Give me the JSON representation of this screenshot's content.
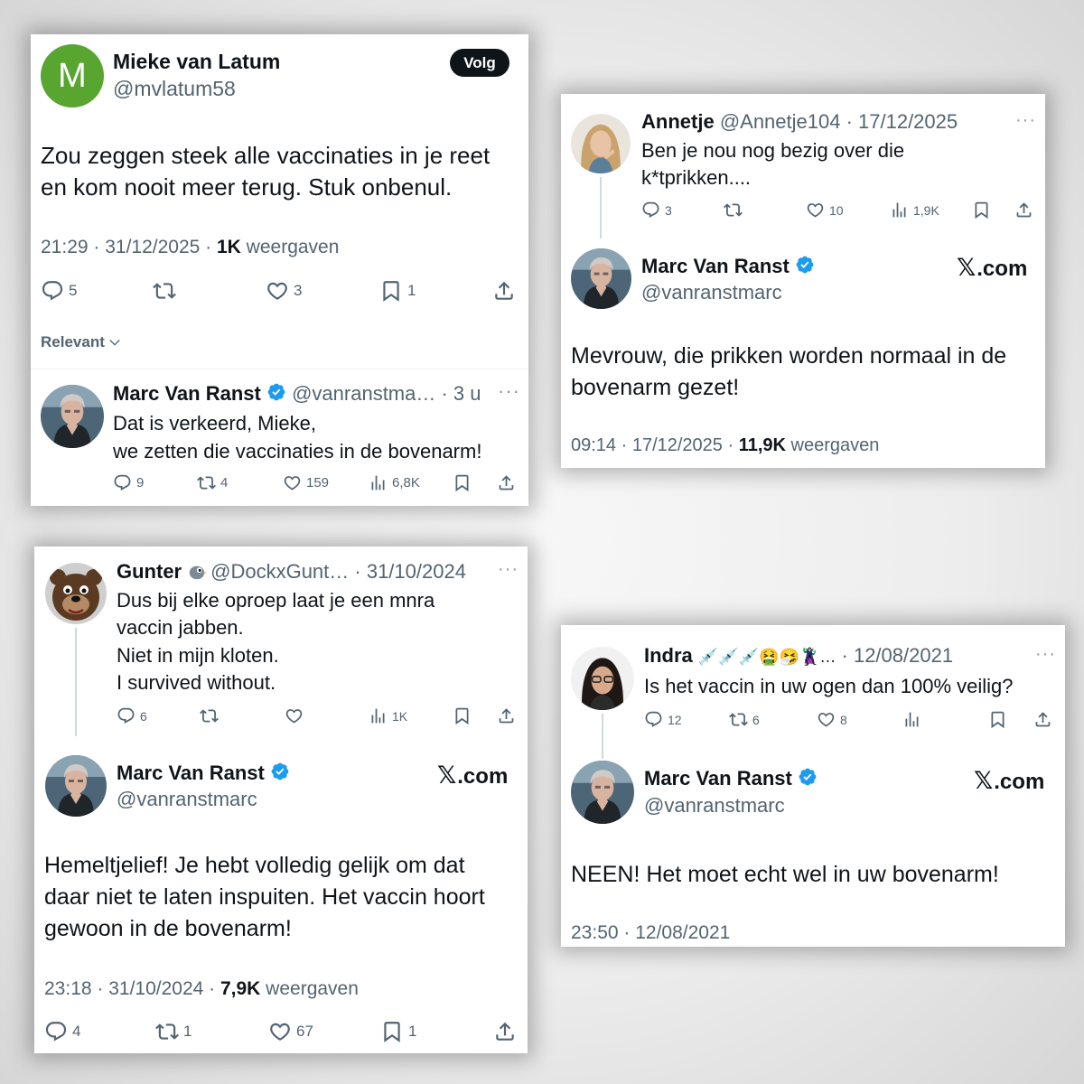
{
  "card1": {
    "author": {
      "name": "Mieke van Latum",
      "handle": "@mvlatum58",
      "avatar_letter": "M",
      "avatar_color": "#58a62f"
    },
    "follow_label": "Volg",
    "text_lines": [
      "Zou zeggen steek alle vaccinaties in je reet",
      "en kom nooit meer terug. Stuk onbenul."
    ],
    "time": "21:29 · 31/12/2025 · ",
    "views_count": "1K",
    "views_label": " weergaven",
    "actions": {
      "replies": "5",
      "reposts": "",
      "likes": "3",
      "bookmarks": "1"
    },
    "sort_label": "Relevant",
    "reply": {
      "name": "Marc Van Ranst",
      "handle_time": "@vanranstma… · 3 u",
      "text_lines": [
        "Dat is verkeerd, Mieke,",
        "we zetten die vaccinaties in de bovenarm!"
      ],
      "actions": {
        "replies": "9",
        "reposts": "4",
        "likes": "159",
        "views": "6,8K"
      }
    }
  },
  "card2": {
    "parent": {
      "name": "Annetje",
      "handle_time": "@Annetje104 · 17/12/2025",
      "text_lines": [
        "Ben je nou nog bezig over die",
        "k*tprikken...."
      ],
      "actions": {
        "replies": "3",
        "reposts": "",
        "likes": "10",
        "views": "1,9K"
      }
    },
    "main": {
      "name": "Marc Van Ranst",
      "handle": "@vanranstmarc",
      "site": ".com",
      "text_lines": [
        "Mevrouw, die prikken worden normaal in de",
        "bovenarm gezet!"
      ],
      "time": "09:14 · 17/12/2025 · ",
      "views_count": "11,9K",
      "views_label": " weergaven"
    }
  },
  "card3": {
    "parent": {
      "name": "Gunter",
      "handle_time": "@DockxGunt… · 31/10/2024",
      "text_lines": [
        "Dus bij elke oproep laat je een mnra",
        "vaccin jabben.",
        "Niet in mijn kloten.",
        "I survived without."
      ],
      "actions": {
        "replies": "6",
        "reposts": "",
        "likes": "",
        "views": "1K"
      }
    },
    "main": {
      "name": "Marc Van Ranst",
      "handle": "@vanranstmarc",
      "site": ".com",
      "text_lines": [
        "Hemeltjelief! Je hebt volledig gelijk om dat",
        "daar niet te laten inspuiten. Het vaccin hoort",
        "gewoon in de bovenarm!"
      ],
      "time": "23:18 · 31/10/2024 · ",
      "views_count": "7,9K",
      "views_label": " weergaven",
      "actions": {
        "replies": "4",
        "reposts": "1",
        "likes": "67",
        "bookmarks": "1"
      }
    }
  },
  "card4": {
    "parent": {
      "name": "Indra",
      "name_suffix": "💉💉💉🤮🤧🦹🏻‍♀️…",
      "handle_time": " · 12/08/2021",
      "text_lines": [
        "Is het vaccin in uw ogen dan 100% veilig?"
      ],
      "actions": {
        "replies": "12",
        "reposts": "6",
        "likes": "8",
        "views": ""
      }
    },
    "main": {
      "name": "Marc Van Ranst",
      "handle": "@vanranstmarc",
      "site": ".com",
      "text_lines": [
        "NEEN! Het moet echt wel in uw bovenarm!"
      ],
      "time": "23:50 · 12/08/2021"
    }
  },
  "colors": {
    "verified": "#1d9bf0",
    "text": "#0f1419",
    "secondary": "#536471",
    "thread": "#cfd9de"
  }
}
